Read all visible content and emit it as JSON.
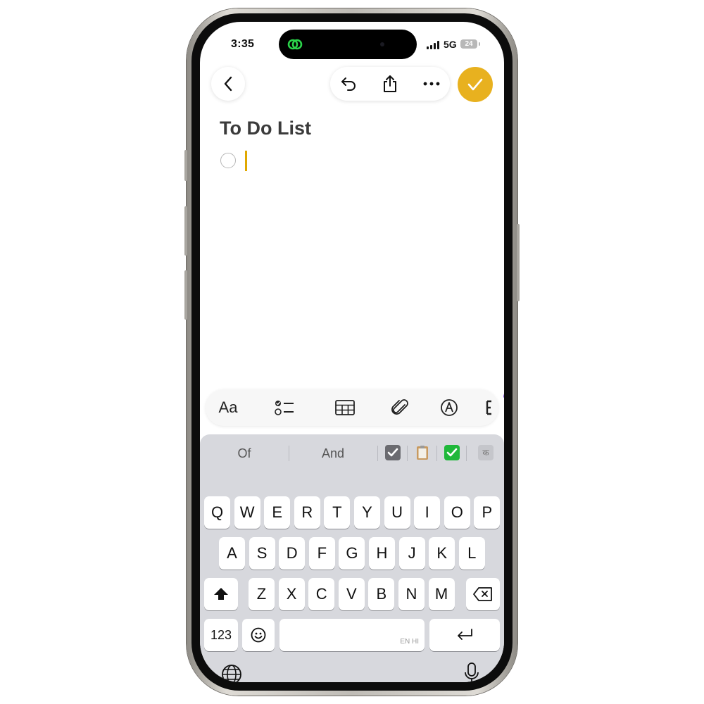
{
  "status_bar": {
    "time": "3:35",
    "network": "5G",
    "battery": "24"
  },
  "nav": {
    "back_icon": "chevron-left-icon",
    "undo_icon": "undo-icon",
    "share_icon": "share-icon",
    "more_icon": "ellipsis-icon",
    "done_icon": "checkmark-icon",
    "accent_color": "#e8b11f"
  },
  "note": {
    "title": "To Do List"
  },
  "format_bar": {
    "text_style_label": "Aa"
  },
  "keyboard": {
    "predictions": [
      "Of",
      "And"
    ],
    "emoji_suggestions": [
      "check-box-emoji",
      "clipboard-emoji",
      "check-mark-button-emoji",
      "hindi-ka-icon"
    ],
    "ka_label": "क",
    "row1": [
      "Q",
      "W",
      "E",
      "R",
      "T",
      "Y",
      "U",
      "I",
      "O",
      "P"
    ],
    "row2": [
      "A",
      "S",
      "D",
      "F",
      "G",
      "H",
      "J",
      "K",
      "L"
    ],
    "row3": [
      "Z",
      "X",
      "C",
      "V",
      "B",
      "N",
      "M"
    ],
    "numbers_label": "123",
    "space_label": "EN HI"
  }
}
